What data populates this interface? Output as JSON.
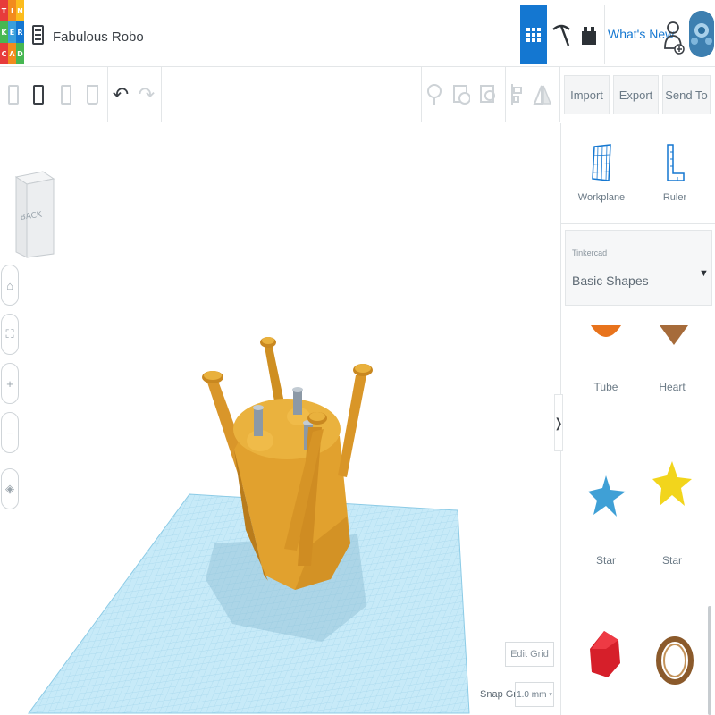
{
  "app": {
    "logo_letters": [
      "T",
      "I",
      "N",
      "K",
      "E",
      "R",
      "C",
      "A",
      "D"
    ],
    "logo_colors": [
      "#e73b3b",
      "#f28b1d",
      "#fcbc1d",
      "#47b752",
      "#3a9fdc",
      "#1477d1",
      "#e73b3b",
      "#f28b1d",
      "#47b752"
    ]
  },
  "document": {
    "title": "Fabulous Robo"
  },
  "header": {
    "whats_new": "What's New"
  },
  "toolbar": {
    "import_label": "Import",
    "export_label": "Export",
    "send_to_label": "Send To"
  },
  "viewcube": {
    "face_label": "BACK"
  },
  "nav_buttons": [
    {
      "name": "home-view-button",
      "icon": "home-icon"
    },
    {
      "name": "fit-view-button",
      "icon": "fit-icon"
    },
    {
      "name": "zoom-in-button",
      "icon": "plus-icon"
    },
    {
      "name": "zoom-out-button",
      "icon": "minus-icon"
    },
    {
      "name": "ortho-view-button",
      "icon": "perspective-icon"
    }
  ],
  "viewport": {
    "edit_grid_label": "Edit Grid",
    "snap_label": "Snap Grid",
    "snap_value": "1.0 mm"
  },
  "panel": {
    "workplane_label": "Workplane",
    "ruler_label": "Ruler",
    "library_category": "Tinkercad",
    "library_selected": "Basic Shapes",
    "shapes": [
      {
        "label": "Tube",
        "color": "#e8731c"
      },
      {
        "label": "Heart",
        "color": "#a66b3a"
      },
      {
        "label": "Star",
        "color": "#3fa0d6"
      },
      {
        "label": "Star",
        "color": "#f2d51c"
      },
      {
        "label": "",
        "color": "#d61f2a"
      },
      {
        "label": "",
        "color": "#8b5a2b"
      }
    ]
  },
  "colors": {
    "accent": "#1477d1",
    "model": "#e1a12e",
    "workplane": "#bfe6f7"
  }
}
